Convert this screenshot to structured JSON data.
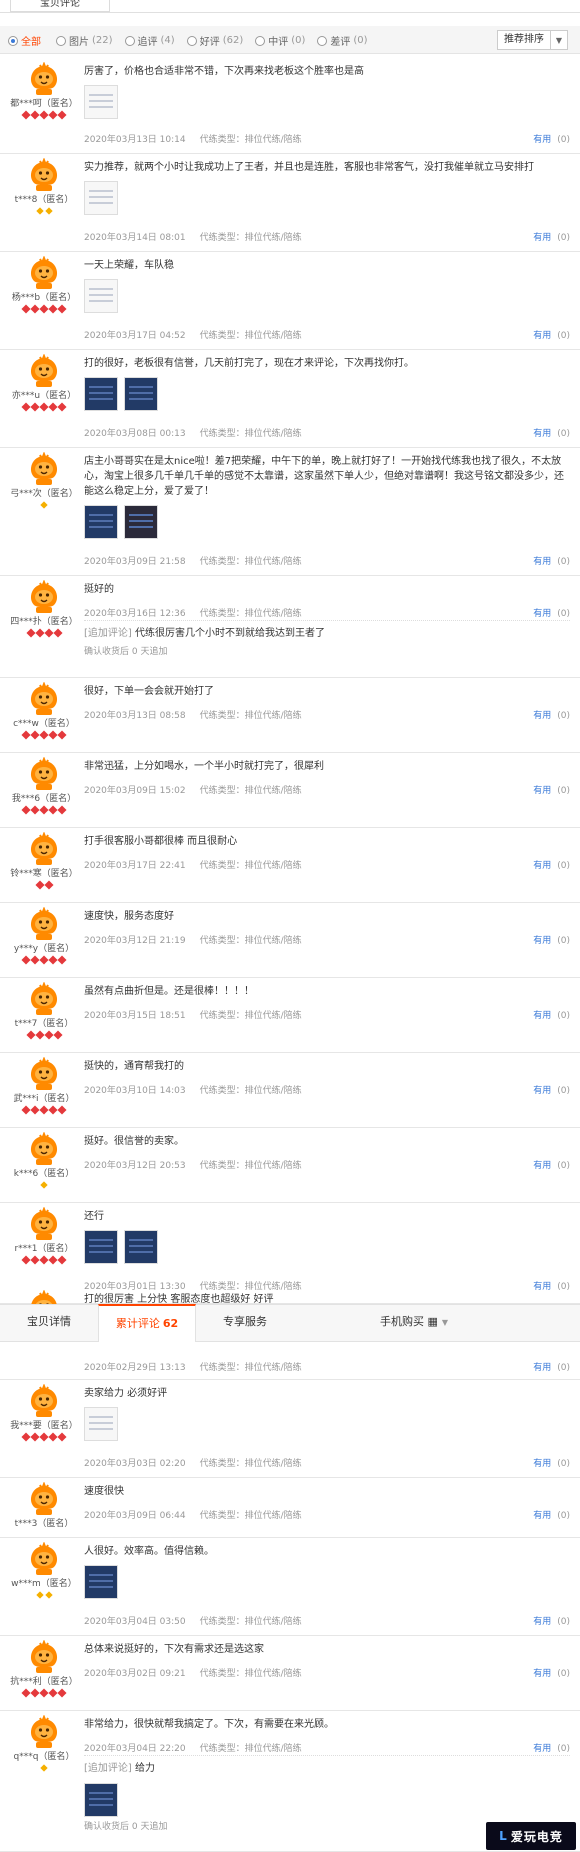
{
  "top_tab": "宝贝评论",
  "filters": [
    {
      "label": "全部",
      "count": "",
      "checked": true
    },
    {
      "label": "图片",
      "count": "(22)",
      "checked": false
    },
    {
      "label": "追评",
      "count": "(4)",
      "checked": false
    },
    {
      "label": "好评",
      "count": "(62)",
      "checked": false
    },
    {
      "label": "中评",
      "count": "(0)",
      "checked": false
    },
    {
      "label": "差评",
      "count": "(0)",
      "checked": false
    }
  ],
  "sort_label": "推荐排序",
  "useful_label": "有用",
  "service_label": "代练类型：排位代练/陪练",
  "confirm_text": "确认收货后 0 天追加",
  "append_tag": "[追加评论]",
  "reviews": [
    {
      "user": "都***呵（匿名）",
      "level": "hearts5",
      "text": "厉害了，价格也合适非常不错，下次再来找老板这个胜率也是高",
      "date": "2020年03月13日 10:14",
      "useful": "(0)"
    },
    {
      "user": "t***8（匿名）",
      "level": "diamonds2",
      "text": "实力推荐，就两个小时让我成功上了王者，并且也是连胜，客服也非常客气，没打我催单就立马安排打",
      "date": "2020年03月14日 08:01",
      "useful": "(0)"
    },
    {
      "user": "杨***b（匿名）",
      "level": "hearts5",
      "text": "一天上荣耀，车队稳",
      "date": "2020年03月17日 04:52",
      "useful": "(0)"
    },
    {
      "user": "亦***u（匿名）",
      "level": "hearts5",
      "text": "打的很好，老板很有信誉，几天前打完了，现在才来评论，下次再找你打。",
      "date": "2020年03月08日 00:13",
      "useful": "(0)"
    },
    {
      "user": "弓***次（匿名）",
      "level": "diamonds1",
      "text": "店主小哥哥实在是太nice啦！差7把荣耀，中午下的单，晚上就打好了！一开始找代练我也找了很久，不太放心，淘宝上很多几千单几千单的感觉不太靠谱，这家虽然下单人少，但绝对靠谱啊！我这号铭文都没多少，还能这么稳定上分，爱了爱了！",
      "date": "2020年03月09日 21:58",
      "useful": "(0)"
    },
    {
      "user": "四***扑（匿名）",
      "level": "hearts4",
      "text": "挺好的",
      "date": "2020年03月16日 12:36",
      "useful": "(0)",
      "append": "代练很厉害几个小时不到就给我达到王者了"
    },
    {
      "user": "c***w（匿名）",
      "level": "hearts5",
      "text": "很好，下单一会会就开始打了",
      "date": "2020年03月13日 08:58",
      "useful": "(0)"
    },
    {
      "user": "我***6（匿名）",
      "level": "hearts5",
      "text": "非常迅猛，上分如喝水，一个半小时就打完了，很犀利",
      "date": "2020年03月09日 15:02",
      "useful": "(0)"
    },
    {
      "user": "铃***寒（匿名）",
      "level": "hearts2",
      "text": "打手很客服小哥都很棒 而且很耐心",
      "date": "2020年03月17日 22:41",
      "useful": "(0)"
    },
    {
      "user": "y***y（匿名）",
      "level": "hearts5",
      "text": "速度快，服务态度好",
      "date": "2020年03月12日 21:19",
      "useful": "(0)"
    },
    {
      "user": "t***7（匿名）",
      "level": "hearts4",
      "text": "虽然有点曲折但是。还是很棒！！！！",
      "date": "2020年03月15日 18:51",
      "useful": "(0)"
    },
    {
      "user": "武***i（匿名）",
      "level": "hearts5",
      "text": "挺快的，通宵帮我打的",
      "date": "2020年03月10日 14:03",
      "useful": "(0)"
    },
    {
      "user": "k***6（匿名）",
      "level": "diamonds1",
      "text": "挺好。很信誉的卖家。",
      "date": "2020年03月12日 20:53",
      "useful": "(0)"
    },
    {
      "user": "r***1（匿名）",
      "level": "hearts5",
      "text": "还行",
      "date": "2020年03月01日 13:30",
      "useful": "(0)"
    },
    {
      "user": "",
      "level": "",
      "text": "打的很厉害 上分快 客服态度也超级好 好评",
      "date": "2020年02月29日 13:13",
      "useful": "(0)"
    },
    {
      "user": "我***要（匿名）",
      "level": "hearts5",
      "text": "卖家给力 必须好评",
      "date": "2020年03月03日 02:20",
      "useful": "(0)"
    },
    {
      "user": "t***3（匿名）",
      "level": "",
      "text": "速度很快",
      "date": "2020年03月09日 06:44",
      "useful": "(0)"
    },
    {
      "user": "w***m（匿名）",
      "level": "diamonds2",
      "text": "人很好。效率高。值得信赖。",
      "date": "2020年03月04日 03:50",
      "useful": "(0)"
    },
    {
      "user": "抗***利（匿名）",
      "level": "hearts5",
      "text": "总体来说挺好的，下次有需求还是选这家",
      "date": "2020年03月02日 09:21",
      "useful": "(0)"
    },
    {
      "user": "q***q（匿名）",
      "level": "diamonds1",
      "text": "非常给力，很快就帮我搞定了。下次，有需要在来光顾。",
      "date": "2020年03月04日 22:20",
      "useful": "(0)",
      "append": "给力"
    }
  ],
  "sticky_tabs": {
    "detail": "宝贝详情",
    "reviews": "累计评论",
    "reviews_count": "62",
    "service": "专享服务",
    "mobile": "手机购买"
  },
  "watermark": "爱玩电竞",
  "watermark_mark": "L"
}
